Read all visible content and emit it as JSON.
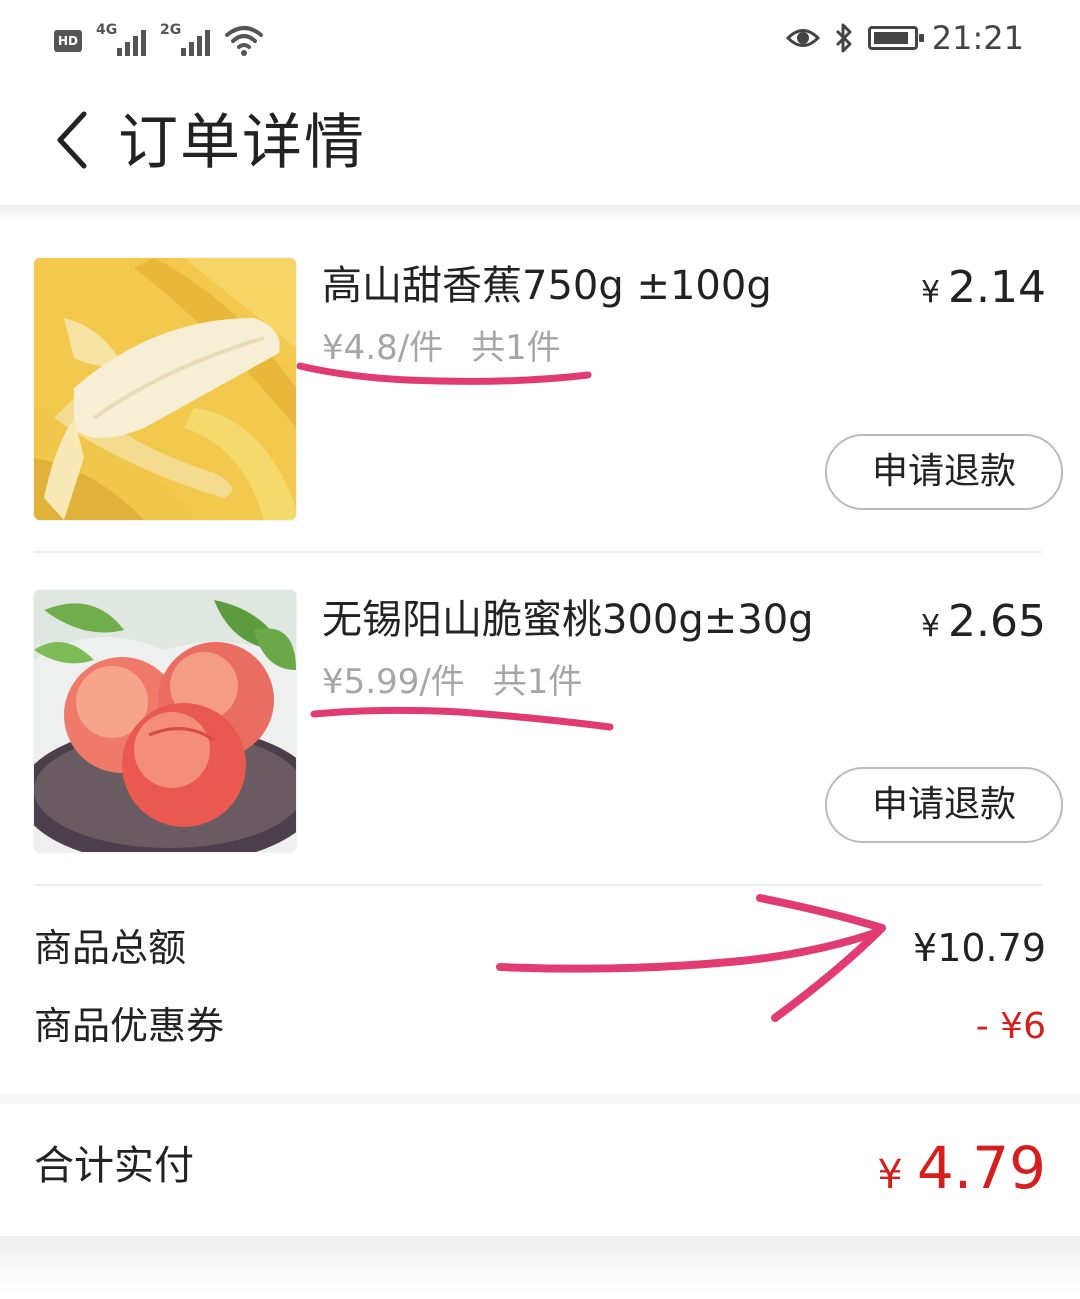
{
  "status_bar": {
    "hd_label": "HD",
    "network_1": "4G",
    "network_2": "2G",
    "time": "21:21",
    "icons": [
      "signal-icon",
      "wifi-icon",
      "eye-icon",
      "bluetooth-icon",
      "battery-icon"
    ]
  },
  "header": {
    "back_icon": "chevron-left-icon",
    "title": "订单详情"
  },
  "items": [
    {
      "image": "banana-image",
      "name": "高山甜香蕉750g ±100g",
      "unit_price": "¥4.8/件",
      "quantity": "共1件",
      "price_symbol": "¥",
      "price": "2.14",
      "refund_label": "申请退款"
    },
    {
      "image": "peach-image",
      "name": "无锡阳山脆蜜桃300g±30g",
      "unit_price": "¥5.99/件",
      "quantity": "共1件",
      "price_symbol": "¥",
      "price": "2.65",
      "refund_label": "申请退款"
    }
  ],
  "summary": {
    "goods_total_label": "商品总额",
    "goods_total_value": "¥10.79",
    "coupon_label": "商品优惠券",
    "coupon_value": "- ¥6"
  },
  "total": {
    "label": "合计实付",
    "symbol": "¥",
    "value": "4.79"
  },
  "colors": {
    "accent_red": "#d51f1f",
    "muted_text": "#a6a6a6",
    "annotation_pink": "#e23b72"
  }
}
